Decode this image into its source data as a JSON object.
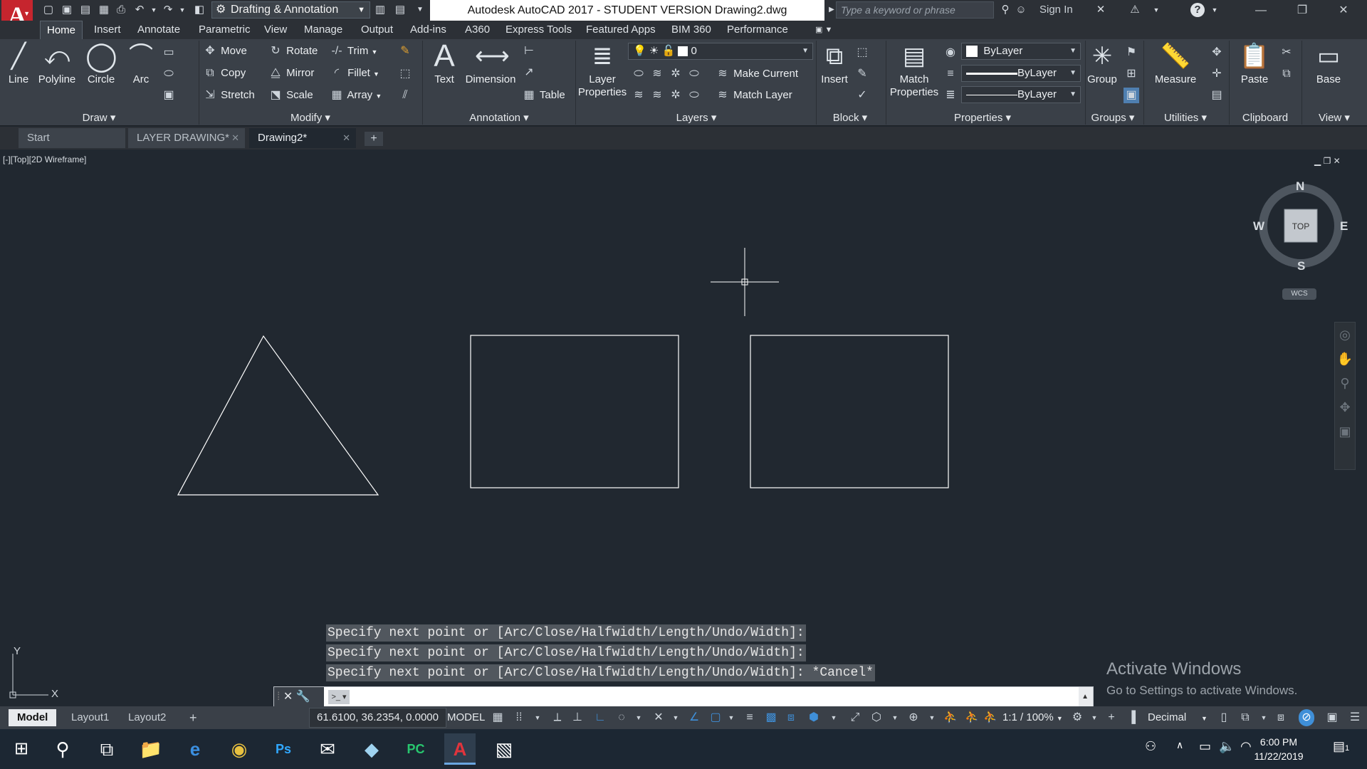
{
  "app": {
    "logo": "A",
    "workspace": "Drafting & Annotation",
    "title": "Autodesk AutoCAD 2017 - STUDENT VERSION    Drawing2.dwg",
    "search_placeholder": "Type a keyword or phrase",
    "sign_in": "Sign In"
  },
  "menu_tabs": [
    "Home",
    "Insert",
    "Annotate",
    "Parametric",
    "View",
    "Manage",
    "Output",
    "Add-ins",
    "A360",
    "Express Tools",
    "Featured Apps",
    "BIM 360",
    "Performance"
  ],
  "ribbon": {
    "draw": {
      "title": "Draw",
      "line": "Line",
      "polyline": "Polyline",
      "circle": "Circle",
      "arc": "Arc"
    },
    "modify": {
      "title": "Modify",
      "move": "Move",
      "rotate": "Rotate",
      "trim": "Trim",
      "copy": "Copy",
      "mirror": "Mirror",
      "fillet": "Fillet",
      "stretch": "Stretch",
      "scale": "Scale",
      "array": "Array"
    },
    "annotation": {
      "title": "Annotation",
      "text": "Text",
      "dimension": "Dimension",
      "table": "Table"
    },
    "layers": {
      "title": "Layers",
      "layer_properties_1": "Layer",
      "layer_properties_2": "Properties",
      "current_layer": "0",
      "make_current": "Make Current",
      "match_layer": "Match Layer"
    },
    "block": {
      "title": "Block",
      "insert": "Insert"
    },
    "properties": {
      "title": "Properties",
      "match_1": "Match",
      "match_2": "Properties",
      "color": "ByLayer",
      "lineweight": "ByLayer",
      "linetype": "ByLayer"
    },
    "groups": {
      "title": "Groups",
      "group": "Group"
    },
    "utilities": {
      "title": "Utilities",
      "measure": "Measure"
    },
    "clipboard": {
      "title": "Clipboard",
      "paste": "Paste"
    },
    "view": {
      "title": "View",
      "base": "Base"
    }
  },
  "file_tabs": [
    "Start",
    "LAYER DRAWING*",
    "Drawing2*"
  ],
  "viewport": {
    "label": "[-][Top][2D Wireframe]",
    "compass": {
      "n": "N",
      "s": "S",
      "e": "E",
      "w": "W",
      "top": "TOP"
    },
    "wcs": "WCS",
    "ucs_x": "X",
    "ucs_y": "Y"
  },
  "command_history": [
    "Specify next point or [Arc/Close/Halfwidth/Length/Undo/Width]:",
    "Specify next point or [Arc/Close/Halfwidth/Length/Undo/Width]:",
    "Specify next point or [Arc/Close/Halfwidth/Length/Undo/Width]: *Cancel*"
  ],
  "command_input": "",
  "watermark": {
    "line1": "Activate Windows",
    "line2": "Go to Settings to activate Windows."
  },
  "layout_tabs": [
    "Model",
    "Layout1",
    "Layout2"
  ],
  "status": {
    "coordinates": "61.6100, 36.2354, 0.0000",
    "model": "MODEL",
    "scale": "1:1 / 100%",
    "units": "Decimal"
  },
  "taskbar": {
    "time": "6:00 PM",
    "date": "11/22/2019",
    "notifications": "1"
  },
  "colors": {
    "canvas": "#212830",
    "ribbon": "#3a4048",
    "accent": "#c6252e",
    "geometry": "#ffffff"
  }
}
